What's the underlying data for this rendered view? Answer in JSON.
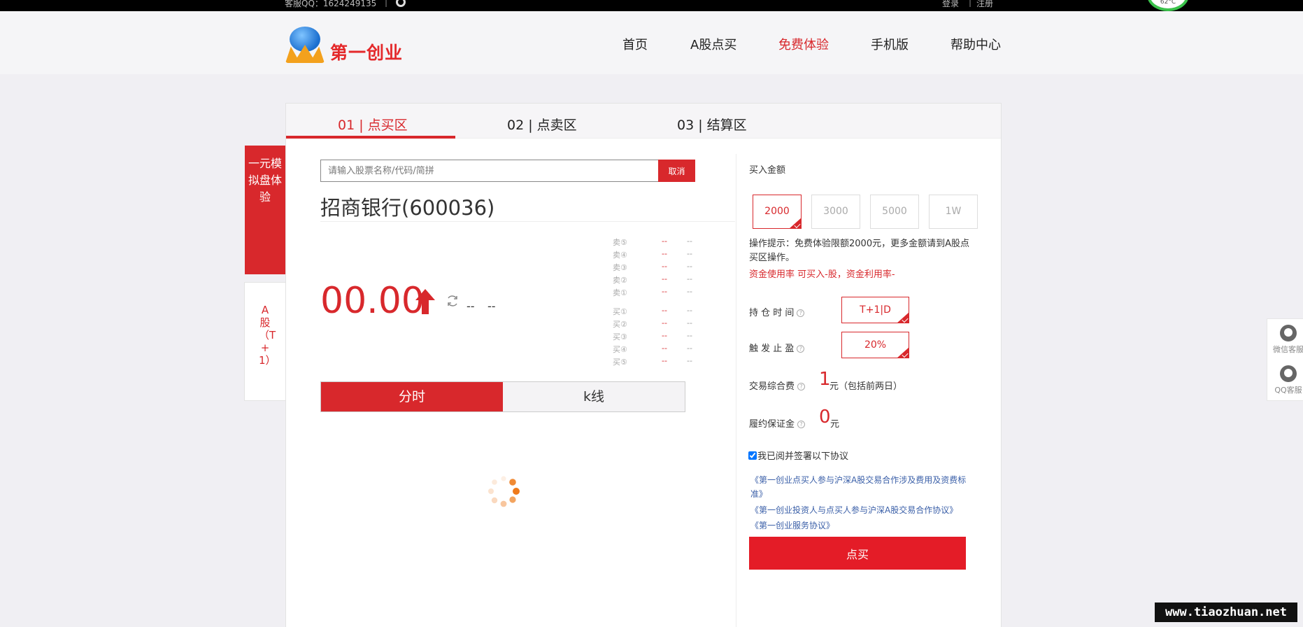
{
  "topbar": {
    "qq": "客服QQ：1624249135",
    "separator": "|",
    "login": "登录",
    "bar": "|",
    "register": "注册",
    "temperature": "62°C"
  },
  "header": {
    "brand": "第一创业",
    "nav": [
      "首页",
      "A股点买",
      "免费体验",
      "手机版",
      "帮助中心"
    ],
    "active_nav": "免费体验"
  },
  "tabs": [
    "01 | 点买区",
    "02 | 点卖区",
    "03 | 结算区"
  ],
  "side": {
    "trial": "一元模拟盘体验",
    "a_share": "A股（T+1）"
  },
  "search": {
    "placeholder": "请输入股票名称/代码/简拼",
    "cancel": "取消"
  },
  "stock": {
    "title": "招商银行(600036)",
    "price": "00.00",
    "change": "--",
    "change_pct": "--"
  },
  "order_book": {
    "sell": [
      {
        "label": "卖⑤",
        "price": "--",
        "volume": "--"
      },
      {
        "label": "卖④",
        "price": "--",
        "volume": "--"
      },
      {
        "label": "卖③",
        "price": "--",
        "volume": "--"
      },
      {
        "label": "卖②",
        "price": "--",
        "volume": "--"
      },
      {
        "label": "卖①",
        "price": "--",
        "volume": "--"
      }
    ],
    "buy": [
      {
        "label": "买①",
        "price": "--",
        "volume": "--"
      },
      {
        "label": "买②",
        "price": "--",
        "volume": "--"
      },
      {
        "label": "买③",
        "price": "--",
        "volume": "--"
      },
      {
        "label": "买④",
        "price": "--",
        "volume": "--"
      },
      {
        "label": "买⑤",
        "price": "--",
        "volume": "--"
      }
    ]
  },
  "chart_tabs": [
    "分时",
    "k线"
  ],
  "buy_panel": {
    "amount_label": "买入金额",
    "amounts": [
      "2000",
      "3000",
      "5000",
      "1W"
    ],
    "selected_amount": "2000",
    "tip": "操作提示：免费体验限额2000元，更多金额请到A股点买区操作。",
    "capital_line": "资金使用率 可买入-股，资金利用率-",
    "hold_label": "持 仓 时 间",
    "hold_value": "T+1|D",
    "stop_label": "触 发 止 盈",
    "stop_value": "20%",
    "fee_label": "交易综合费",
    "fee_value": "1",
    "fee_unit": "元（包括前两日）",
    "deposit_label": "履约保证金",
    "deposit_value": "0",
    "deposit_unit": "元",
    "qmark": "?",
    "agree_text": "我已阅并签署以下协议",
    "links": [
      "《第一创业点买人参与沪深A股交易合作涉及费用及资费标准》",
      "《第一创业投资人与点买人参与沪深A股交易合作协议》",
      "《第一创业服务协议》"
    ],
    "buy_button": "点买"
  },
  "service": {
    "wechat": "微信客服",
    "qq": "QQ客服"
  },
  "watermark": "www.tiaozhuan.net",
  "colors": {
    "accent": "#d8282c",
    "buy_button": "#e41c27",
    "link": "#3a5fa8"
  }
}
